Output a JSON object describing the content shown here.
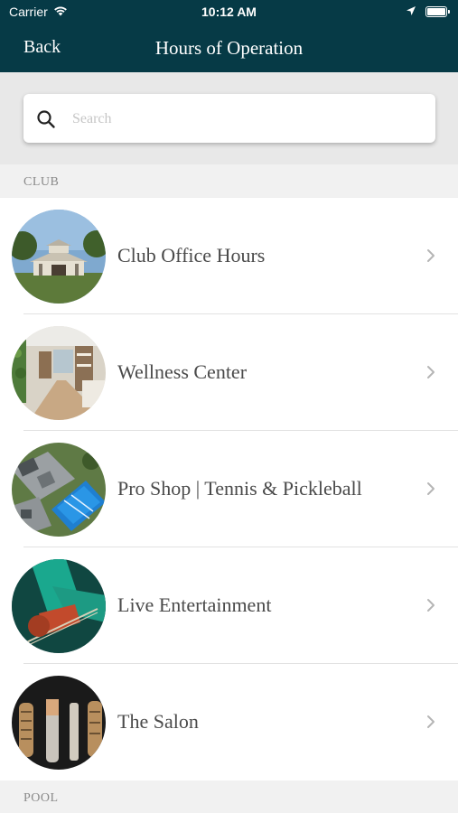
{
  "status_bar": {
    "carrier": "Carrier",
    "time": "10:12 AM"
  },
  "nav": {
    "back_label": "Back",
    "title": "Hours of Operation"
  },
  "search": {
    "placeholder": "Search",
    "value": ""
  },
  "sections": [
    {
      "header": "CLUB",
      "items": [
        {
          "label": "Club Office Hours",
          "image": "clubhouse-building-photo"
        },
        {
          "label": "Wellness Center",
          "image": "wellness-interior-photo"
        },
        {
          "label": "Pro Shop | Tennis & Pickleball",
          "image": "tennis-courts-aerial-photo"
        },
        {
          "label": "Live Entertainment",
          "image": "guitar-player-photo"
        },
        {
          "label": "The Salon",
          "image": "hair-brushes-photo"
        }
      ]
    },
    {
      "header": "POOL",
      "items": []
    }
  ],
  "colors": {
    "nav_background": "#063a46",
    "text": "#4a4a4a",
    "section_text": "#8a8a8a"
  }
}
